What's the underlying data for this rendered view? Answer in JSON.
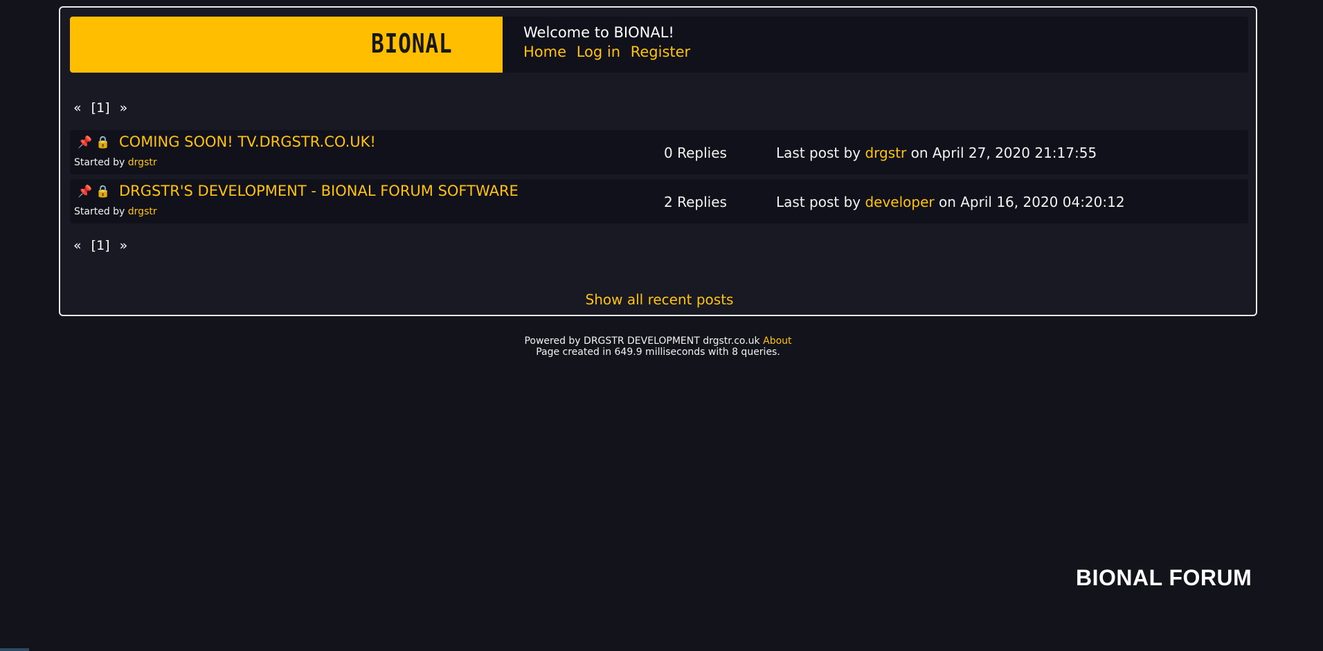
{
  "header": {
    "logo_text": "BIONAL",
    "welcome": "Welcome to BIONAL!",
    "nav": [
      "Home",
      "Log in",
      "Register"
    ]
  },
  "pagination": {
    "prev": "«",
    "current": "[1]",
    "next": "»"
  },
  "topics": [
    {
      "title": "COMING SOON! TV.DRGSTR.CO.UK!",
      "started_by_label": "Started by",
      "author": "drgstr",
      "replies": "0 Replies",
      "last_post_prefix": "Last post by",
      "last_post_user": "drgstr",
      "last_post_date": "on April 27, 2020 21:17:55"
    },
    {
      "title": "DRGSTR'S DEVELOPMENT - BIONAL FORUM SOFTWARE",
      "started_by_label": "Started by",
      "author": "drgstr",
      "replies": "2 Replies",
      "last_post_prefix": "Last post by",
      "last_post_user": "developer",
      "last_post_date": "on April 16, 2020 04:20:12"
    }
  ],
  "show_recent": "Show all recent posts",
  "footer": {
    "powered": "Powered by DRGSTR DEVELOPMENT drgstr.co.uk",
    "about": "About",
    "created": "Page created in 649.9 milliseconds with 8 queries."
  },
  "brand": "BIONAL FORUM",
  "colors": {
    "accent": "#ffc20e",
    "banner": "#ffbe00",
    "background": "#13131b",
    "panel": "#181922",
    "row": "#10111a",
    "pin": "#c8263a"
  },
  "icons": [
    "pin-icon",
    "lock-icon"
  ]
}
